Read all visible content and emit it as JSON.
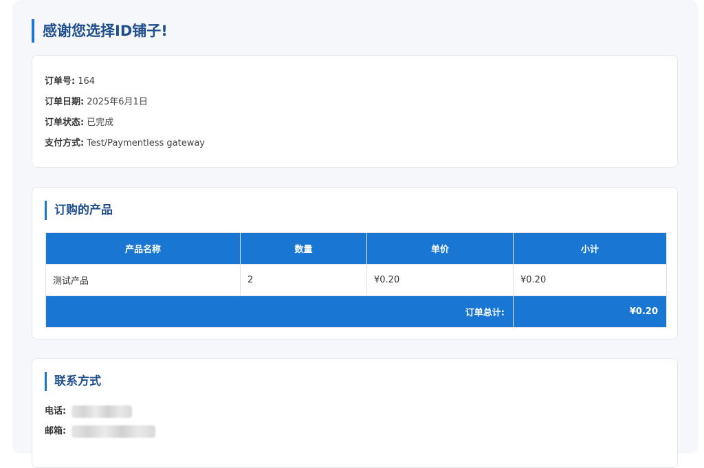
{
  "header": {
    "title": "感谢您选择ID铺子!"
  },
  "order_info": {
    "number_label": "订单号:",
    "number_value": "164",
    "date_label": "订单日期:",
    "date_value": "2025年6月1日",
    "status_label": "订单状态:",
    "status_value": "已完成",
    "payment_label": "支付方式:",
    "payment_value": "Test/Paymentless gateway"
  },
  "products": {
    "title": "订购的产品",
    "headers": [
      "产品名称",
      "数量",
      "单价",
      "小计"
    ],
    "rows": [
      {
        "name": "测试产品",
        "qty": "2",
        "price": "¥0.20",
        "subtotal": "¥0.20"
      }
    ],
    "total_label": "订单总计:",
    "total_value": "¥0.20"
  },
  "contact": {
    "title": "联系方式",
    "phone_label": "电话:",
    "email_label": "邮箱:"
  },
  "colors": {
    "accent": "#1976d2",
    "title": "#1f4e8c",
    "background": "#f5f7fb"
  }
}
